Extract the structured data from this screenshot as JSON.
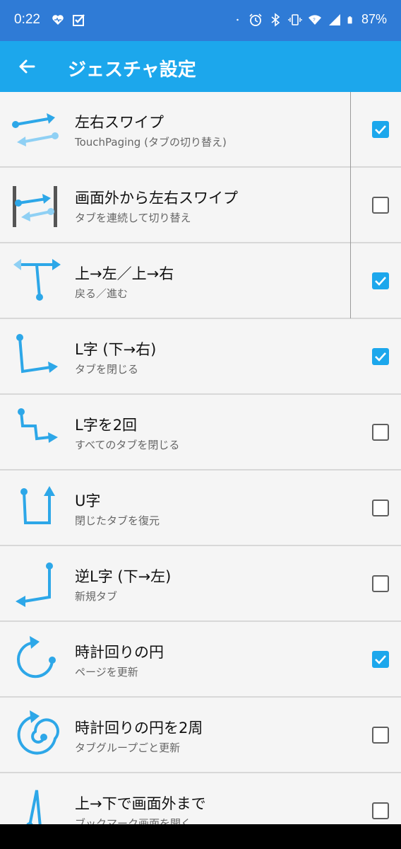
{
  "status_bar": {
    "time": "0:22",
    "battery": "87%",
    "icons": [
      "heart-icon",
      "checkbox-icon",
      "dot-icon",
      "alarm-icon",
      "bluetooth-icon",
      "vibrate-icon",
      "wifi-icon",
      "signal-icon",
      "battery-icon"
    ]
  },
  "app_bar": {
    "title": "ジェスチャ設定",
    "back_icon": "back-arrow-icon"
  },
  "colors": {
    "status_bar": "#2f7bd6",
    "app_bar": "#1ca7ec",
    "accent": "#1ca7ec",
    "gesture_stroke": "#2da7e8",
    "gesture_light": "#8fd0f4"
  },
  "gestures": [
    {
      "title": "左右スワイプ",
      "subtitle": "TouchPaging (タブの切り替え)",
      "checked": true,
      "icon": "swipe-left-right-icon"
    },
    {
      "title": "画面外から左右スワイプ",
      "subtitle": "タブを連続して切り替え",
      "checked": false,
      "icon": "edge-swipe-icon"
    },
    {
      "title": "上→左／上→右",
      "subtitle": "戻る／進む",
      "checked": true,
      "icon": "up-left-right-icon"
    },
    {
      "title": "L字 (下→右)",
      "subtitle": "タブを閉じる",
      "checked": true,
      "icon": "l-shape-icon"
    },
    {
      "title": "L字を2回",
      "subtitle": "すべてのタブを閉じる",
      "checked": false,
      "icon": "double-l-icon"
    },
    {
      "title": "U字",
      "subtitle": "閉じたタブを復元",
      "checked": false,
      "icon": "u-shape-icon"
    },
    {
      "title": "逆L字 (下→左)",
      "subtitle": "新規タブ",
      "checked": false,
      "icon": "reverse-l-icon"
    },
    {
      "title": "時計回りの円",
      "subtitle": "ページを更新",
      "checked": true,
      "icon": "clockwise-circle-icon"
    },
    {
      "title": "時計回りの円を2周",
      "subtitle": "タブグループごと更新",
      "checked": false,
      "icon": "double-circle-icon"
    },
    {
      "title": "上→下で画面外まで",
      "subtitle": "ブックマーク画面を開く",
      "checked": false,
      "icon": "up-down-offscreen-icon"
    }
  ]
}
